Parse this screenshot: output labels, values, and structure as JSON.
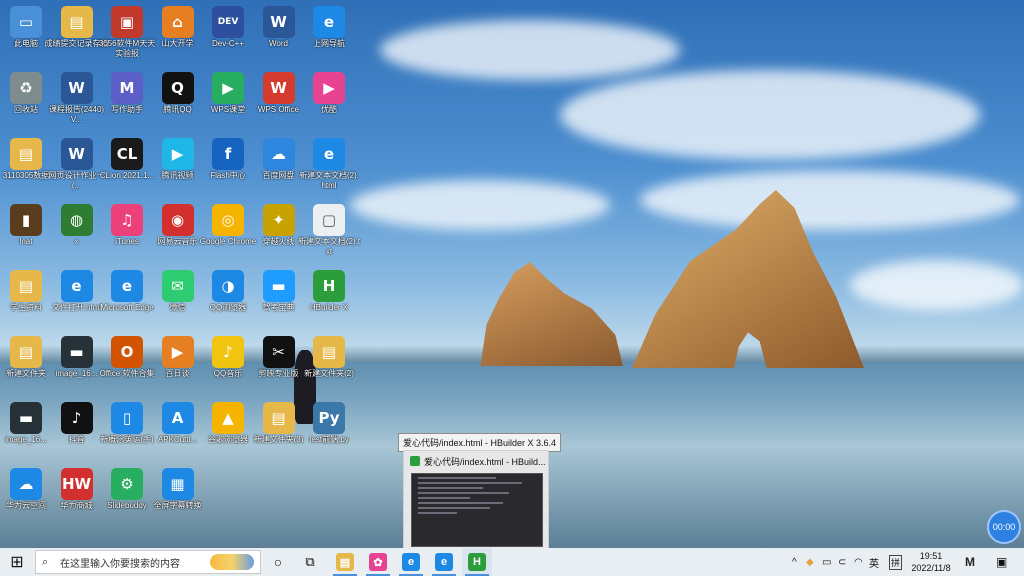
{
  "desktop": {
    "icons": [
      {
        "label": "此电脑",
        "glyph": "▭",
        "color": "#4a90d9"
      },
      {
        "label": "成绩提交记录存档",
        "glyph": "▤",
        "color": "#e6b84a"
      },
      {
        "label": "3056软件M天天实验报",
        "glyph": "▣",
        "color": "#c0392b"
      },
      {
        "label": "山大开学",
        "glyph": "⌂",
        "color": "#e67e22"
      },
      {
        "label": "Dev-C++",
        "glyph": "DEV",
        "color": "#2d4f9e"
      },
      {
        "label": "Word",
        "glyph": "W",
        "color": "#2b5797"
      },
      {
        "label": "上网导航",
        "glyph": "e",
        "color": "#1e88e5"
      },
      {
        "label": "回收站",
        "glyph": "♻",
        "color": "#7f8c8d"
      },
      {
        "label": "课程报告(2440) V...",
        "glyph": "W",
        "color": "#2b5797"
      },
      {
        "label": "写作助手",
        "glyph": "M",
        "color": "#5b5fc7"
      },
      {
        "label": "腾讯QQ",
        "glyph": "Q",
        "color": "#111111"
      },
      {
        "label": "WPS课堂",
        "glyph": "▶",
        "color": "#27ae60"
      },
      {
        "label": "WPS Office",
        "glyph": "W",
        "color": "#d63b30"
      },
      {
        "label": "优酷",
        "glyph": "▶",
        "color": "#e84393"
      },
      {
        "label": "3110305数据",
        "glyph": "▤",
        "color": "#e6b84a"
      },
      {
        "label": "网页设计作业一 (...",
        "glyph": "W",
        "color": "#2b5797"
      },
      {
        "label": "CLion 2021.1...",
        "glyph": "CL",
        "color": "#1a1a1a"
      },
      {
        "label": "腾讯视频",
        "glyph": "▶",
        "color": "#1fb6e8"
      },
      {
        "label": "Flash中心",
        "glyph": "f",
        "color": "#1565c0"
      },
      {
        "label": "百度网盘",
        "glyph": "☁",
        "color": "#2e86de"
      },
      {
        "label": "新建文本文档(2).html",
        "glyph": "e",
        "color": "#1e88e5"
      },
      {
        "label": "lnat",
        "glyph": "▮",
        "color": "#5a3d1e"
      },
      {
        "label": "x",
        "glyph": "◍",
        "color": "#2e7d32"
      },
      {
        "label": "iTunes",
        "glyph": "♫",
        "color": "#ec407a"
      },
      {
        "label": "网易云音乐",
        "glyph": "◉",
        "color": "#d32f2f"
      },
      {
        "label": "Google Chrome",
        "glyph": "◎",
        "color": "#f4b400"
      },
      {
        "label": "穿越火线",
        "glyph": "✦",
        "color": "#c8a200"
      },
      {
        "label": "新建文本文档(2).txt",
        "glyph": "▢",
        "color": "#eceff1"
      },
      {
        "label": "学生资料",
        "glyph": "▤",
        "color": "#e6b84a"
      },
      {
        "label": "文件打开.html",
        "glyph": "e",
        "color": "#1e88e5"
      },
      {
        "label": "Microsoft Edge",
        "glyph": "e",
        "color": "#1e88e5"
      },
      {
        "label": "微信",
        "glyph": "✉",
        "color": "#2ecc71"
      },
      {
        "label": "QQ浏览器",
        "glyph": "◑",
        "color": "#1e88e5"
      },
      {
        "label": "驾考宝典",
        "glyph": "▬",
        "color": "#1e9cff"
      },
      {
        "label": "HBuilder X",
        "glyph": "H",
        "color": "#2b9d3a"
      },
      {
        "label": "新建文件夹",
        "glyph": "▤",
        "color": "#e6b84a"
      },
      {
        "label": "image_16...",
        "glyph": "▬",
        "color": "#263238"
      },
      {
        "label": "Office 软件合集",
        "glyph": "O",
        "color": "#d35400"
      },
      {
        "label": "百日谈",
        "glyph": "▶",
        "color": "#e67e22"
      },
      {
        "label": "QQ音乐",
        "glyph": "♪",
        "color": "#f1c40f"
      },
      {
        "label": "剪映专业版",
        "glyph": "✂",
        "color": "#111111"
      },
      {
        "label": "新建文件夹(2)",
        "glyph": "▤",
        "color": "#e6b84a"
      },
      {
        "label": "image_16...",
        "glyph": "▬",
        "color": "#263238"
      },
      {
        "label": "抖音",
        "glyph": "♪",
        "color": "#111111"
      },
      {
        "label": "新概念英语(手)",
        "glyph": "▯",
        "color": "#1e88e5"
      },
      {
        "label": "APKCuttl...",
        "glyph": "A",
        "color": "#1e88e5"
      },
      {
        "label": "谷歌浏览器",
        "glyph": "▲",
        "color": "#f4b400"
      },
      {
        "label": "新建文件夹(3)",
        "glyph": "▤",
        "color": "#e6b84a"
      },
      {
        "label": "test前端.py",
        "glyph": "Py",
        "color": "#3b77a8"
      },
      {
        "label": "华为云空间",
        "glyph": "☁",
        "color": "#1e88e5"
      },
      {
        "label": "华为商城",
        "glyph": "HW",
        "color": "#d32f2f"
      },
      {
        "label": "Slidebuddy",
        "glyph": "⚙",
        "color": "#27ae60"
      },
      {
        "label": "全屏字幕转换",
        "glyph": "▦",
        "color": "#1e88e5"
      }
    ]
  },
  "tooltip": {
    "text": "爱心代码/index.html - HBuilder X 3.6.4"
  },
  "preview": {
    "title": "爱心代码/index.html - HBuild..."
  },
  "timer": {
    "text": "00:00"
  },
  "taskbar": {
    "start_glyph": "⊞",
    "search_glyph": "⌕",
    "search_placeholder": "在这里输入你要搜索的内容",
    "cortana_glyph": "○",
    "taskview_glyph": "⧉",
    "apps": [
      {
        "name": "file-explorer",
        "glyph": "▤",
        "color": "#e6b84a"
      },
      {
        "name": "paint",
        "glyph": "✿",
        "color": "#e84393"
      },
      {
        "name": "ie",
        "glyph": "e",
        "color": "#1e88e5"
      },
      {
        "name": "edge",
        "glyph": "e",
        "color": "#1e88e5"
      },
      {
        "name": "hbuilder",
        "glyph": "H",
        "color": "#2b9d3a"
      }
    ],
    "tray": {
      "chevron": "^",
      "ime": "英",
      "keyboard": "拼",
      "time": "19:51",
      "date": "2022/11/8",
      "notification_glyph": "▣"
    }
  }
}
